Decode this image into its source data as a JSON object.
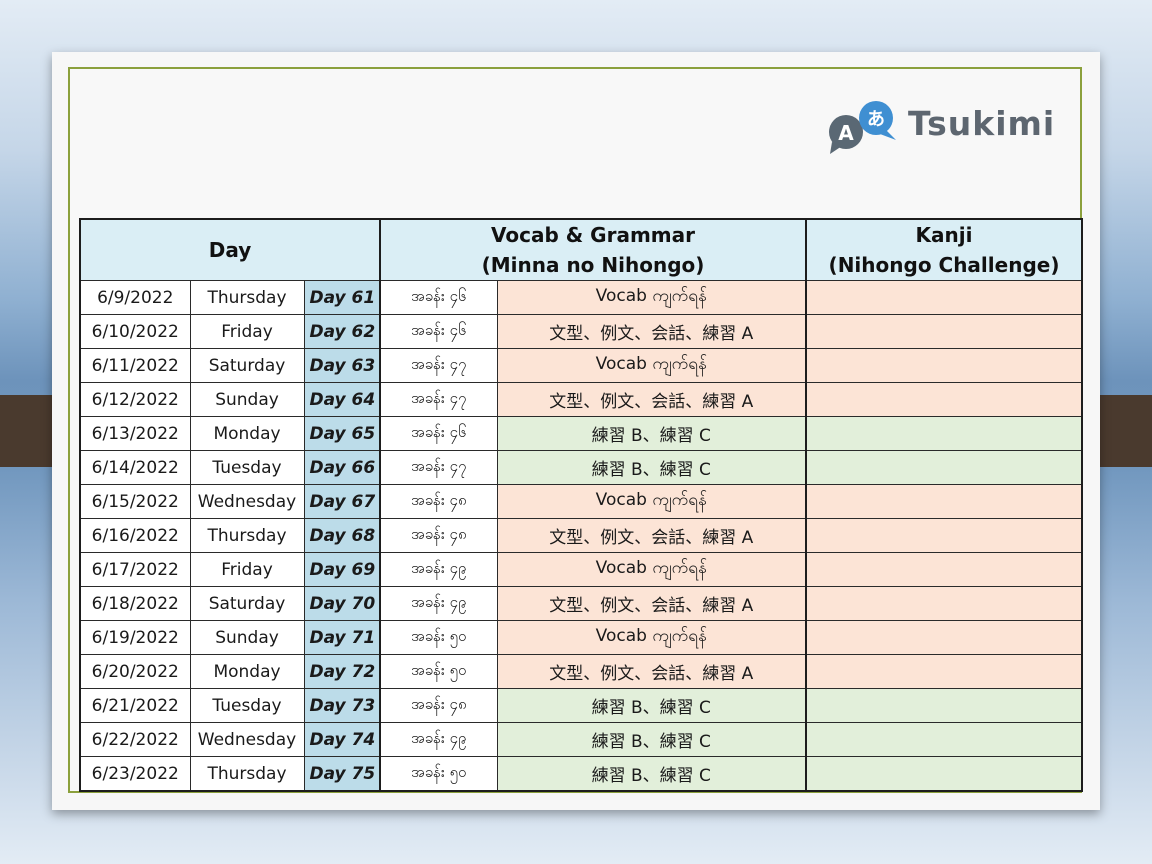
{
  "brand": {
    "name": "Tsukimi",
    "icon_letters": [
      "A",
      "あ"
    ]
  },
  "headers": {
    "day": "Day",
    "vocab_line1": "Vocab & Grammar",
    "vocab_line2": "(Minna no Nihongo)",
    "kanji_line1": "Kanji",
    "kanji_line2": "(Nihongo Challenge)"
  },
  "colors": {
    "header_bg": "#daeef5",
    "day_bg": "#bcdce9",
    "peach": "#fce4d6",
    "green": "#e2efda",
    "frame": "#8ba03c"
  },
  "rows": [
    {
      "date": "6/9/2022",
      "weekday": "Thursday",
      "day": "Day 61",
      "lesson": "အခန်း ၄၆",
      "activity": "Vocab ကျက်ရန်",
      "kanji": "",
      "tone": "peach"
    },
    {
      "date": "6/10/2022",
      "weekday": "Friday",
      "day": "Day 62",
      "lesson": "အခန်း ၄၆",
      "activity": "文型、例文、会話、練習 A",
      "kanji": "",
      "tone": "peach"
    },
    {
      "date": "6/11/2022",
      "weekday": "Saturday",
      "day": "Day 63",
      "lesson": "အခန်း ၄၇",
      "activity": "Vocab ကျက်ရန်",
      "kanji": "",
      "tone": "peach"
    },
    {
      "date": "6/12/2022",
      "weekday": "Sunday",
      "day": "Day 64",
      "lesson": "အခန်း ၄၇",
      "activity": "文型、例文、会話、練習 A",
      "kanji": "",
      "tone": "peach"
    },
    {
      "date": "6/13/2022",
      "weekday": "Monday",
      "day": "Day 65",
      "lesson": "အခန်း ၄၆",
      "activity": "練習 B、練習 C",
      "kanji": "",
      "tone": "green"
    },
    {
      "date": "6/14/2022",
      "weekday": "Tuesday",
      "day": "Day 66",
      "lesson": "အခန်း ၄၇",
      "activity": "練習 B、練習 C",
      "kanji": "",
      "tone": "green"
    },
    {
      "date": "6/15/2022",
      "weekday": "Wednesday",
      "day": "Day 67",
      "lesson": "အခန်း ၄၈",
      "activity": "Vocab ကျက်ရန်",
      "kanji": "",
      "tone": "peach"
    },
    {
      "date": "6/16/2022",
      "weekday": "Thursday",
      "day": "Day 68",
      "lesson": "အခန်း ၄၈",
      "activity": "文型、例文、会話、練習 A",
      "kanji": "",
      "tone": "peach"
    },
    {
      "date": "6/17/2022",
      "weekday": "Friday",
      "day": "Day 69",
      "lesson": "အခန်း ၄၉",
      "activity": "Vocab ကျက်ရန်",
      "kanji": "",
      "tone": "peach"
    },
    {
      "date": "6/18/2022",
      "weekday": "Saturday",
      "day": "Day 70",
      "lesson": "အခန်း ၄၉",
      "activity": "文型、例文、会話、練習 A",
      "kanji": "",
      "tone": "peach"
    },
    {
      "date": "6/19/2022",
      "weekday": "Sunday",
      "day": "Day 71",
      "lesson": "အခန်း ၅၀",
      "activity": "Vocab ကျက်ရန်",
      "kanji": "",
      "tone": "peach"
    },
    {
      "date": "6/20/2022",
      "weekday": "Monday",
      "day": "Day 72",
      "lesson": "အခန်း ၅၀",
      "activity": "文型、例文、会話、練習 A",
      "kanji": "",
      "tone": "peach"
    },
    {
      "date": "6/21/2022",
      "weekday": "Tuesday",
      "day": "Day 73",
      "lesson": "အခန်း ၄၈",
      "activity": "練習 B、練習 C",
      "kanji": "",
      "tone": "green"
    },
    {
      "date": "6/22/2022",
      "weekday": "Wednesday",
      "day": "Day 74",
      "lesson": "အခန်း ၄၉",
      "activity": "練習 B、練習 C",
      "kanji": "",
      "tone": "green"
    },
    {
      "date": "6/23/2022",
      "weekday": "Thursday",
      "day": "Day 75",
      "lesson": "အခန်း ၅၀",
      "activity": "練習 B、練習 C",
      "kanji": "",
      "tone": "green"
    }
  ]
}
